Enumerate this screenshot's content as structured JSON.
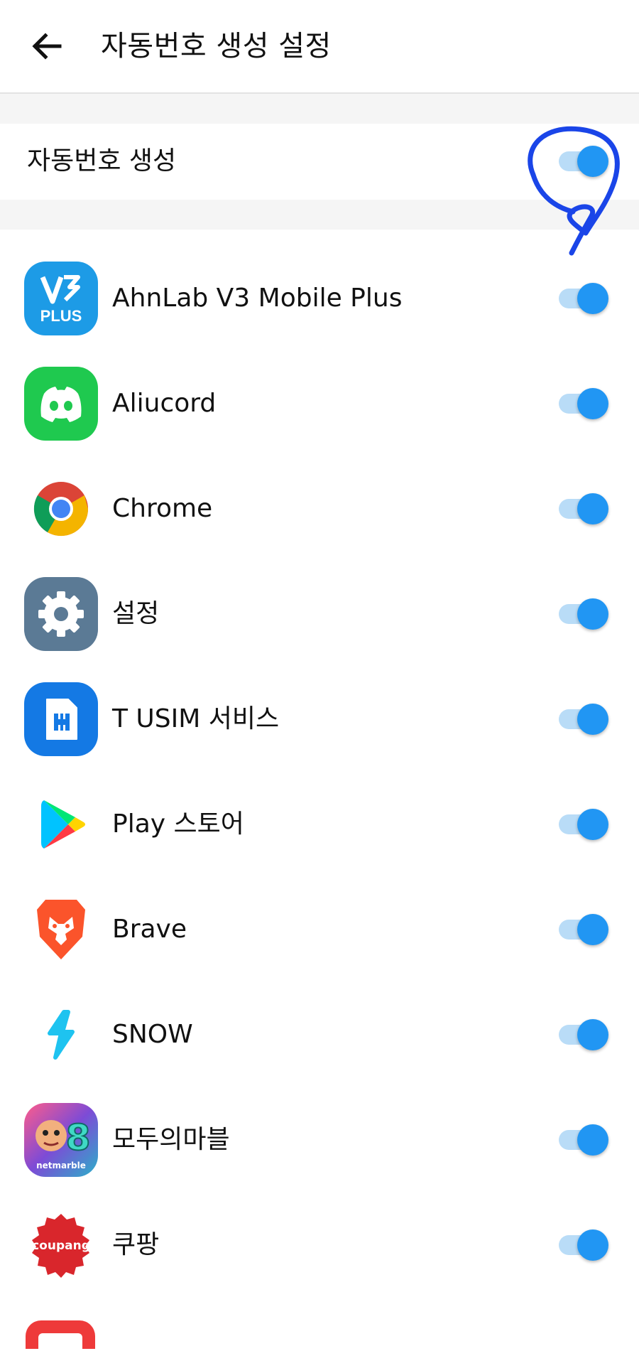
{
  "header": {
    "title": "자동번호 생성 설정",
    "back_icon": "arrow-left-icon"
  },
  "master": {
    "label": "자동번호 생성",
    "enabled": true
  },
  "colors": {
    "accent": "#2196f3",
    "track_on": "#b9dcf7",
    "annotation": "#1a45e8"
  },
  "apps": [
    {
      "name": "AhnLab V3 Mobile Plus",
      "icon": "v3-plus-icon",
      "enabled": true
    },
    {
      "name": "Aliucord",
      "icon": "discord-icon",
      "enabled": true
    },
    {
      "name": "Chrome",
      "icon": "chrome-icon",
      "enabled": true
    },
    {
      "name": "설정",
      "icon": "settings-gear-icon",
      "enabled": true
    },
    {
      "name": "T USIM 서비스",
      "icon": "sim-card-icon",
      "enabled": true
    },
    {
      "name": "Play 스토어",
      "icon": "play-store-icon",
      "enabled": true
    },
    {
      "name": "Brave",
      "icon": "brave-lion-icon",
      "enabled": true
    },
    {
      "name": "SNOW",
      "icon": "snow-bolt-icon",
      "enabled": true
    },
    {
      "name": "모두의마블",
      "icon": "netmarble-game-icon",
      "enabled": true,
      "icon_text": "netmarble"
    },
    {
      "name": "쿠팡",
      "icon": "coupang-icon",
      "enabled": true,
      "icon_text": "coupang"
    }
  ]
}
